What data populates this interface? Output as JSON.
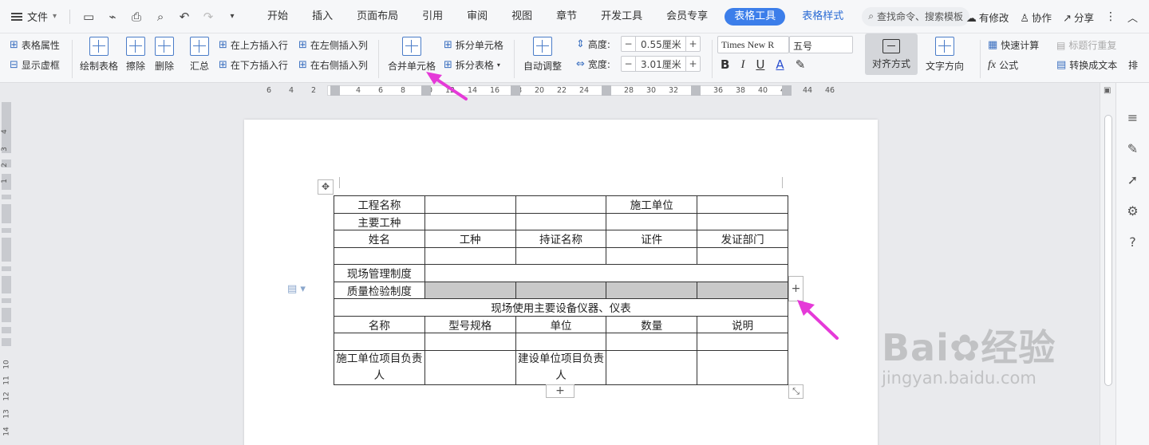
{
  "menubar": {
    "file_label": "文件",
    "tabs": [
      {
        "label": "开始"
      },
      {
        "label": "插入"
      },
      {
        "label": "页面布局"
      },
      {
        "label": "引用"
      },
      {
        "label": "审阅"
      },
      {
        "label": "视图"
      },
      {
        "label": "章节"
      },
      {
        "label": "开发工具"
      },
      {
        "label": "会员专享"
      },
      {
        "label": "表格工具"
      },
      {
        "label": "表格样式"
      }
    ],
    "search_placeholder": "查找命令、搜索模板",
    "right": {
      "modified": "有修改",
      "collab": "协作",
      "share": "分享"
    }
  },
  "ribbon": {
    "table_props": "表格属性",
    "show_gridlines": "显示虚框",
    "draw_table": "绘制表格",
    "erase": "擦除",
    "delete": "删除",
    "summary": "汇总",
    "insert_above": "在上方插入行",
    "insert_below": "在下方插入行",
    "insert_left": "在左侧插入列",
    "insert_right": "在右侧插入列",
    "merge_cells": "合并单元格",
    "split_cells": "拆分单元格",
    "split_table": "拆分表格",
    "auto_adjust": "自动调整",
    "height_label": "高度:",
    "height_value": "0.55厘米",
    "width_label": "宽度:",
    "width_value": "3.01厘米",
    "font_name": "Times New R",
    "font_size": "五号",
    "align": "对齐方式",
    "text_direction": "文字方向",
    "quick_calc": "快速计算",
    "title_repeat": "标题行重复",
    "formula": "公式",
    "convert_text": "转换成文本",
    "more": "排"
  },
  "ruler_ticks": [
    "6",
    "4",
    "2",
    "2",
    "4",
    "6",
    "8",
    "10",
    "12",
    "14",
    "16",
    "18",
    "20",
    "22",
    "24",
    "26",
    "28",
    "30",
    "32",
    "34",
    "36",
    "38",
    "40",
    "42",
    "44",
    "46"
  ],
  "vruler_ticks": [
    "4",
    "3",
    "2",
    "1",
    "1",
    "2",
    "3",
    "4",
    "5",
    "6",
    "7",
    "8",
    "9",
    "10",
    "11",
    "12",
    "13",
    "14"
  ],
  "table": {
    "rows": [
      [
        "工程名称",
        "",
        "",
        "施工单位",
        ""
      ],
      [
        "主要工种",
        "",
        "",
        "",
        ""
      ],
      [
        "姓名",
        "工种",
        "持证名称",
        "证件",
        "发证部门"
      ],
      [
        "",
        "",
        "",
        "",
        ""
      ],
      [
        "现场管理制度",
        ""
      ],
      [
        "质量检验制度",
        "",
        "",
        "",
        ""
      ],
      [
        "现场使用主要设备仪器、仪表"
      ],
      [
        "名称",
        "型号规格",
        "单位",
        "数量",
        "说明"
      ],
      [
        "",
        "",
        "",
        "",
        ""
      ],
      [
        "施工单位项目负责人",
        "",
        "建设单位项目负责人",
        "",
        ""
      ]
    ]
  },
  "watermark": {
    "brand": "Bai",
    "brand2": "经验",
    "url": "jingyan.baidu.com"
  },
  "colors": {
    "accent": "#3c7eea",
    "arrow": "#e53ad8",
    "selected_cell": "#c9c9c9"
  }
}
